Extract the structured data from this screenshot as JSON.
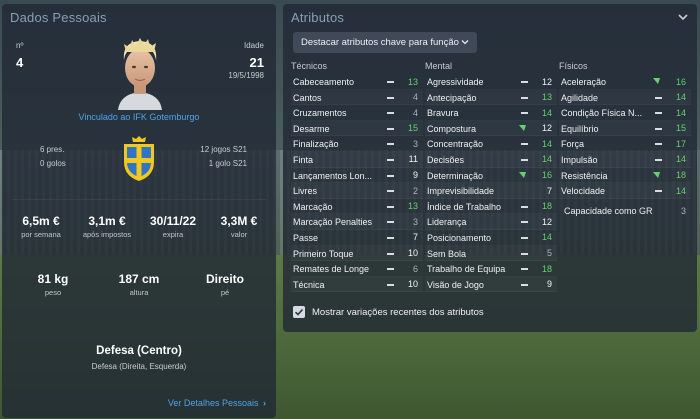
{
  "left": {
    "title": "Dados Pessoais",
    "number_label": "nº",
    "number_value": "4",
    "age_label": "Idade",
    "age_value": "21",
    "birth_date": "19/5/1998",
    "club_link": "Vinculado ao IFK Gotemburgo",
    "caps": "6 pres.",
    "goals": "0 golos",
    "u21_games": "12 jogos S21",
    "u21_goals": "1 golo S21",
    "wage_value": "6,5m €",
    "wage_label": "por semana",
    "after_tax_value": "3,1m €",
    "after_tax_label": "após impostos",
    "expires_value": "30/11/22",
    "expires_label": "expira",
    "value_value": "3,3M €",
    "value_label": "valor",
    "weight_value": "81 kg",
    "weight_label": "peso",
    "height_value": "187 cm",
    "height_label": "altura",
    "foot_value": "Direito",
    "foot_label": "pé",
    "position_main": "Defesa (Centro)",
    "position_sub": "Defesa (Direita, Esquerda)",
    "details_link": "Ver Detalhes Pessoais",
    "details_chevron": "›"
  },
  "right": {
    "title": "Atributos",
    "dropdown_label": "Destacar atributos chave para função",
    "col_technical": "Técnicos",
    "col_mental": "Mental",
    "col_physical": "Físicos",
    "technical": [
      {
        "name": "Cabeceamento",
        "value": "13",
        "color": "green",
        "highlight": true
      },
      {
        "name": "Cantos",
        "value": "4",
        "color": "grey",
        "highlight": true
      },
      {
        "name": "Cruzamentos",
        "value": "4",
        "color": "grey",
        "highlight": true
      },
      {
        "name": "Desarme",
        "value": "15",
        "color": "green",
        "highlight": true
      },
      {
        "name": "Finalização",
        "value": "3",
        "color": "grey",
        "highlight": true
      },
      {
        "name": "Finta",
        "value": "11",
        "color": "white",
        "highlight": true
      },
      {
        "name": "Lançamentos Lon...",
        "value": "9",
        "color": "white",
        "highlight": true
      },
      {
        "name": "Livres",
        "value": "2",
        "color": "grey",
        "highlight": true
      },
      {
        "name": "Marcação",
        "value": "13",
        "color": "green",
        "highlight": true
      },
      {
        "name": "Marcação Penalties",
        "value": "3",
        "color": "grey",
        "highlight": true
      },
      {
        "name": "Passe",
        "value": "7",
        "color": "white",
        "highlight": true
      },
      {
        "name": "Primeiro Toque",
        "value": "10",
        "color": "white",
        "highlight": true
      },
      {
        "name": "Remates de Longe",
        "value": "6",
        "color": "grey",
        "highlight": true
      },
      {
        "name": "Técnica",
        "value": "10",
        "color": "white",
        "highlight": true
      }
    ],
    "mental": [
      {
        "name": "Agressividade",
        "value": "12",
        "color": "white",
        "highlight": true
      },
      {
        "name": "Antecipação",
        "value": "13",
        "color": "green",
        "highlight": true
      },
      {
        "name": "Bravura",
        "value": "14",
        "color": "green",
        "highlight": true
      },
      {
        "name": "Compostura",
        "value": "12",
        "color": "white",
        "highlight": false,
        "arrow": true
      },
      {
        "name": "Concentração",
        "value": "14",
        "color": "green",
        "highlight": true
      },
      {
        "name": "Decisões",
        "value": "14",
        "color": "green",
        "highlight": true
      },
      {
        "name": "Determinação",
        "value": "16",
        "color": "green",
        "highlight": false,
        "arrow": true
      },
      {
        "name": "Imprevisibilidade",
        "value": "7",
        "color": "white",
        "highlight": false
      },
      {
        "name": "Índice de Trabalho",
        "value": "18",
        "color": "green",
        "highlight": true
      },
      {
        "name": "Liderança",
        "value": "12",
        "color": "white",
        "highlight": true
      },
      {
        "name": "Posicionamento",
        "value": "14",
        "color": "green",
        "highlight": true
      },
      {
        "name": "Sem Bola",
        "value": "5",
        "color": "grey",
        "highlight": true
      },
      {
        "name": "Trabalho de Equipa",
        "value": "18",
        "color": "green",
        "highlight": true
      },
      {
        "name": "Visão de Jogo",
        "value": "9",
        "color": "white",
        "highlight": true
      }
    ],
    "physical": [
      {
        "name": "Aceleração",
        "value": "16",
        "color": "green",
        "highlight": false,
        "arrow": true
      },
      {
        "name": "Agilidade",
        "value": "14",
        "color": "green",
        "highlight": true
      },
      {
        "name": "Condição Física N...",
        "value": "14",
        "color": "green",
        "highlight": true
      },
      {
        "name": "Equilíbrio",
        "value": "15",
        "color": "green",
        "highlight": true
      },
      {
        "name": "Força",
        "value": "17",
        "color": "green",
        "highlight": true
      },
      {
        "name": "Impulsão",
        "value": "14",
        "color": "green",
        "highlight": true
      },
      {
        "name": "Resistência",
        "value": "18",
        "color": "green",
        "highlight": false,
        "arrow": true
      },
      {
        "name": "Velocidade",
        "value": "14",
        "color": "green",
        "highlight": true
      }
    ],
    "gk_capacity_label": "Capacidade como GR",
    "gk_capacity_value": "3",
    "show_changes_label": "Mostrar variações recentes dos atributos",
    "show_changes_checked": true
  },
  "colors": {
    "green": "#63d36b",
    "white": "#f2f4f6",
    "grey": "#aab0b8",
    "link": "#4fa3e8",
    "title": "#86a0b8"
  }
}
